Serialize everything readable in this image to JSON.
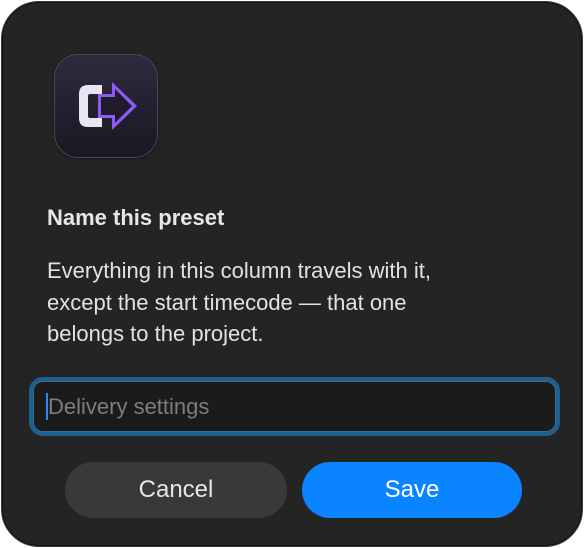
{
  "dialog": {
    "app_icon": "convert-arrow-icon",
    "title": "Name this preset",
    "message_lines": [
      "Everything in this column travels with it,",
      "except the start timecode — that one",
      "belongs to the project."
    ],
    "name_input": {
      "value": "",
      "placeholder": "Delivery settings"
    },
    "buttons": {
      "cancel_label": "Cancel",
      "save_label": "Save"
    },
    "colors": {
      "background": "#242424",
      "accent": "#0a84ff",
      "focus_ring": "#1d5f8f",
      "icon_purple": "#8b5cf6"
    }
  }
}
